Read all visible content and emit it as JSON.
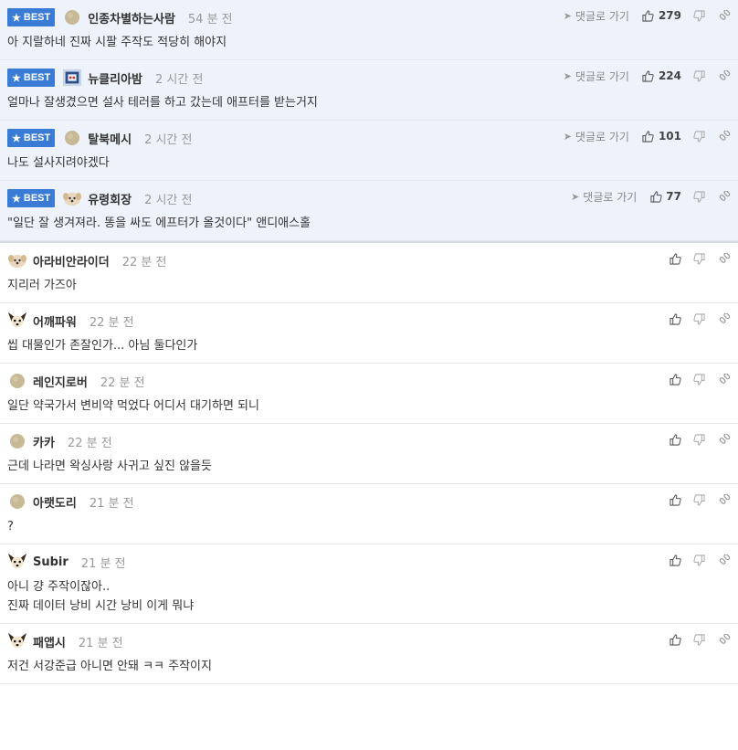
{
  "best_badge": "BEST",
  "reply_label": "댓글로 가기",
  "colors": {
    "badge": "#3a7bd5",
    "best_bg": "#eef3fb"
  },
  "comments": [
    {
      "best": true,
      "avatar": "round-avatar",
      "nick": "인종차별하는사람",
      "time": "54 분 전",
      "likes": "279",
      "text": "아 지랄하네 진짜 시팔 주작도 적당히 해야지"
    },
    {
      "best": true,
      "avatar": "robot-avatar",
      "nick": "뉴클리아밤",
      "time": "2 시간 전",
      "likes": "224",
      "text": "얼마나 잘생겼으면 설사 테러를 하고 갔는데 애프터를 받는거지"
    },
    {
      "best": true,
      "avatar": "round-avatar",
      "nick": "탈북메시",
      "time": "2 시간 전",
      "likes": "101",
      "text": "나도 설사지려야겠다"
    },
    {
      "best": true,
      "avatar": "puppy-avatar",
      "nick": "유령회장",
      "time": "2 시간 전",
      "likes": "77",
      "text": "\"일단 잘 생겨져라. 똥을 싸도 에프터가 올것이다\" 앤디애스홀"
    },
    {
      "best": false,
      "avatar": "puppy-avatar",
      "nick": "아라비안라이더",
      "time": "22 분 전",
      "likes": "",
      "text": "지리러 가즈아"
    },
    {
      "best": false,
      "avatar": "chihuahua-avatar",
      "nick": "어깨파워",
      "time": "22 분 전",
      "likes": "",
      "text": "씹 대물인가 존잘인가... 아님 둘다인가"
    },
    {
      "best": false,
      "avatar": "round-avatar",
      "nick": "레인지로버",
      "time": "22 분 전",
      "likes": "",
      "text": "일단 약국가서 변비약 먹었다 어디서 대기하면 되니"
    },
    {
      "best": false,
      "avatar": "round-avatar",
      "nick": "카카",
      "time": "22 분 전",
      "likes": "",
      "text": "근데 나라면 왁싱사랑 사귀고 싶진 않을듯"
    },
    {
      "best": false,
      "avatar": "round-avatar",
      "nick": "아랫도리",
      "time": "21 분 전",
      "likes": "",
      "text": "?"
    },
    {
      "best": false,
      "avatar": "chihuahua-avatar",
      "nick": "Subir",
      "time": "21 분 전",
      "likes": "",
      "text": "아니 걍 주작이잖아..\n진짜 데이터 낭비 시간 낭비 이게 뭐냐"
    },
    {
      "best": false,
      "avatar": "chihuahua-avatar",
      "nick": "패앱시",
      "time": "21 분 전",
      "likes": "",
      "text": "저건 서강준급 아니면 안돼 ㅋㅋ 주작이지"
    }
  ]
}
